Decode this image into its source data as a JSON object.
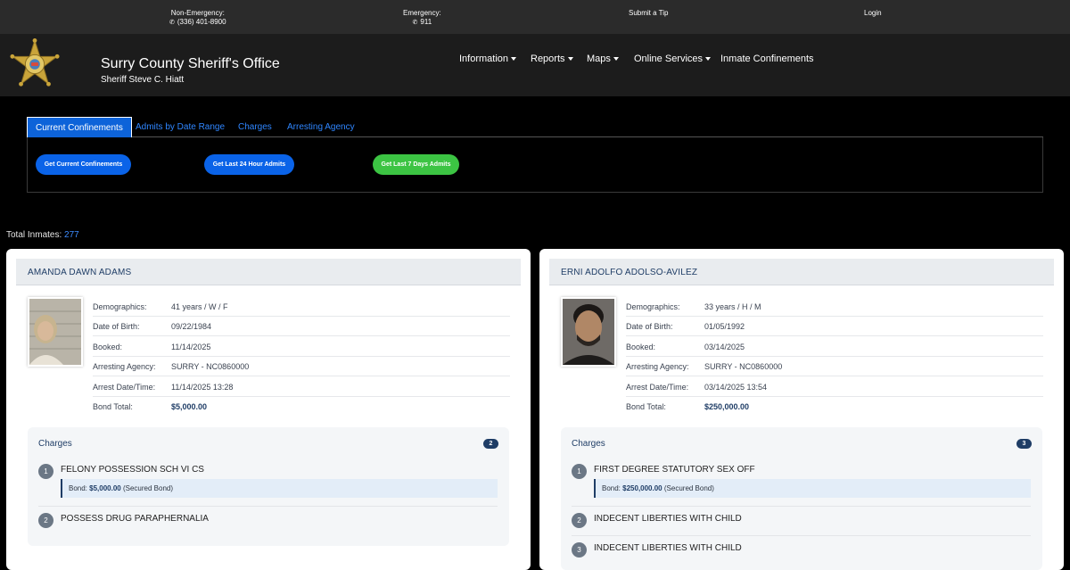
{
  "topbar": {
    "non_emergency_label": "Non-Emergency:",
    "non_emergency_phone": "(336) 401-8900",
    "emergency_label": "Emergency:",
    "emergency_phone": "911",
    "tip": "Submit a Tip",
    "login": "Login"
  },
  "header": {
    "title": "Surry County Sheriff's Office",
    "subtitle": "Sheriff Steve C. Hiatt",
    "logo_icon": "sheriff-star-badge-icon"
  },
  "nav": [
    "Information",
    "Reports",
    "Maps",
    "Online Services",
    "Inmate Confinements"
  ],
  "tabs": [
    "Current Confinements",
    "Admits by Date Range",
    "Charges",
    "Arresting Agency"
  ],
  "buttons": {
    "current": "Get Current Confinements",
    "last24": "Get Last 24 Hour Admits",
    "last7": "Get Last 7 Days Admits"
  },
  "total": {
    "label": "Total Inmates:",
    "count": "277"
  },
  "labels": {
    "demographics": "Demographics:",
    "dob": "Date of Birth:",
    "booked": "Booked:",
    "agency": "Arresting Agency:",
    "arrest": "Arrest Date/Time:",
    "bond": "Bond Total:",
    "charges": "Charges",
    "bond_prefix": "Bond:",
    "secured": "(Secured Bond)"
  },
  "inmates": [
    {
      "name": "AMANDA DAWN ADAMS",
      "demographics": "41 years / W / F",
      "dob": "09/22/1984",
      "booked": "11/14/2025",
      "agency": "SURRY - NC0860000",
      "arrest": "11/14/2025 13:28",
      "bond_total": "$5,000.00",
      "charge_count": "2",
      "charges": [
        {
          "num": "1",
          "name": "FELONY POSSESSION SCH VI CS",
          "bond": "$5,000.00"
        },
        {
          "num": "2",
          "name": "POSSESS DRUG PARAPHERNALIA"
        }
      ]
    },
    {
      "name": "ERNI ADOLFO ADOLSO-AVILEZ",
      "demographics": "33 years / H / M",
      "dob": "01/05/1992",
      "booked": "03/14/2025",
      "agency": "SURRY - NC0860000",
      "arrest": "03/14/2025 13:54",
      "bond_total": "$250,000.00",
      "charge_count": "3",
      "charges": [
        {
          "num": "1",
          "name": "FIRST DEGREE STATUTORY SEX OFF",
          "bond": "$250,000.00"
        },
        {
          "num": "2",
          "name": "INDECENT LIBERTIES WITH CHILD"
        },
        {
          "num": "3",
          "name": "INDECENT LIBERTIES WITH CHILD"
        }
      ]
    }
  ]
}
